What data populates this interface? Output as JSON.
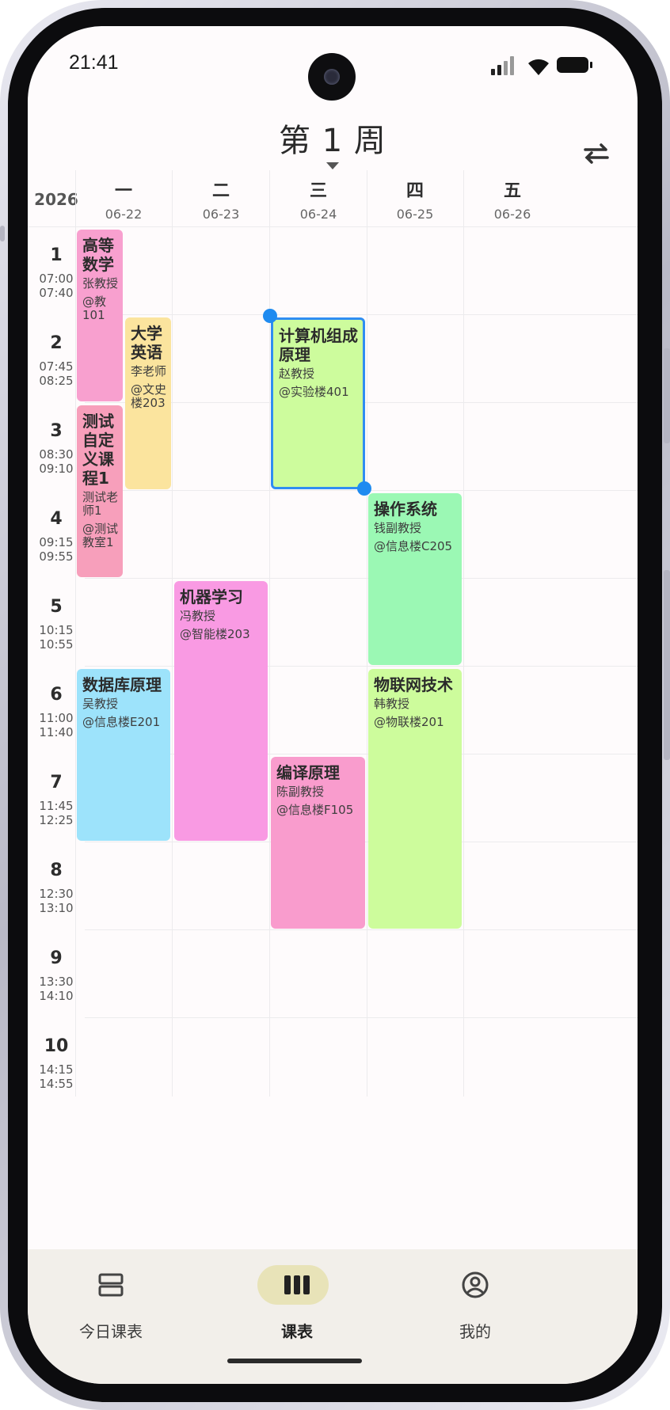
{
  "status": {
    "time": "21:41"
  },
  "header": {
    "title": "第 1 周"
  },
  "grid": {
    "year": "2026",
    "days": [
      {
        "week": "一",
        "date": "06-22"
      },
      {
        "week": "二",
        "date": "06-23"
      },
      {
        "week": "三",
        "date": "06-24"
      },
      {
        "week": "四",
        "date": "06-25"
      },
      {
        "week": "五",
        "date": "06-26"
      }
    ],
    "periods": [
      {
        "no": "1",
        "start": "07:00",
        "end": "07:40"
      },
      {
        "no": "2",
        "start": "07:45",
        "end": "08:25"
      },
      {
        "no": "3",
        "start": "08:30",
        "end": "09:10"
      },
      {
        "no": "4",
        "start": "09:15",
        "end": "09:55"
      },
      {
        "no": "5",
        "start": "10:15",
        "end": "10:55"
      },
      {
        "no": "6",
        "start": "11:00",
        "end": "11:40"
      },
      {
        "no": "7",
        "start": "11:45",
        "end": "12:25"
      },
      {
        "no": "8",
        "start": "12:30",
        "end": "13:10"
      },
      {
        "no": "9",
        "start": "13:30",
        "end": "14:10"
      },
      {
        "no": "10",
        "start": "14:15",
        "end": "14:55"
      }
    ]
  },
  "courses": [
    {
      "name": "高等数学",
      "teacher": "张教授",
      "room": "@教101",
      "color": "#f8a0cf"
    },
    {
      "name": "大学英语",
      "teacher": "李老师",
      "room": "@文史楼203",
      "color": "#fbe49e"
    },
    {
      "name": "测试自定义课程1",
      "teacher": "测试老师1",
      "room": "@测试教室1",
      "color": "#f79fbb"
    },
    {
      "name": "计算机组成原理",
      "teacher": "赵教授",
      "room": "@实验楼401",
      "color": "#cdfc9d"
    },
    {
      "name": "操作系统",
      "teacher": "钱副教授",
      "room": "@信息楼C205",
      "color": "#9bf8b4"
    },
    {
      "name": "机器学习",
      "teacher": "冯教授",
      "room": "@智能楼203",
      "color": "#f99ae3"
    },
    {
      "name": "数据库原理",
      "teacher": "吴教授",
      "room": "@信息楼E201",
      "color": "#9de3fb"
    },
    {
      "name": "物联网技术",
      "teacher": "韩教授",
      "room": "@物联楼201",
      "color": "#cdfc9c"
    },
    {
      "name": "编译原理",
      "teacher": "陈副教授",
      "room": "@信息楼F105",
      "color": "#f99ccd"
    }
  ],
  "tabs": [
    {
      "label": "今日课表",
      "icon": "today-list-icon"
    },
    {
      "label": "课表",
      "icon": "schedule-columns-icon"
    },
    {
      "label": "我的",
      "icon": "profile-icon"
    }
  ]
}
